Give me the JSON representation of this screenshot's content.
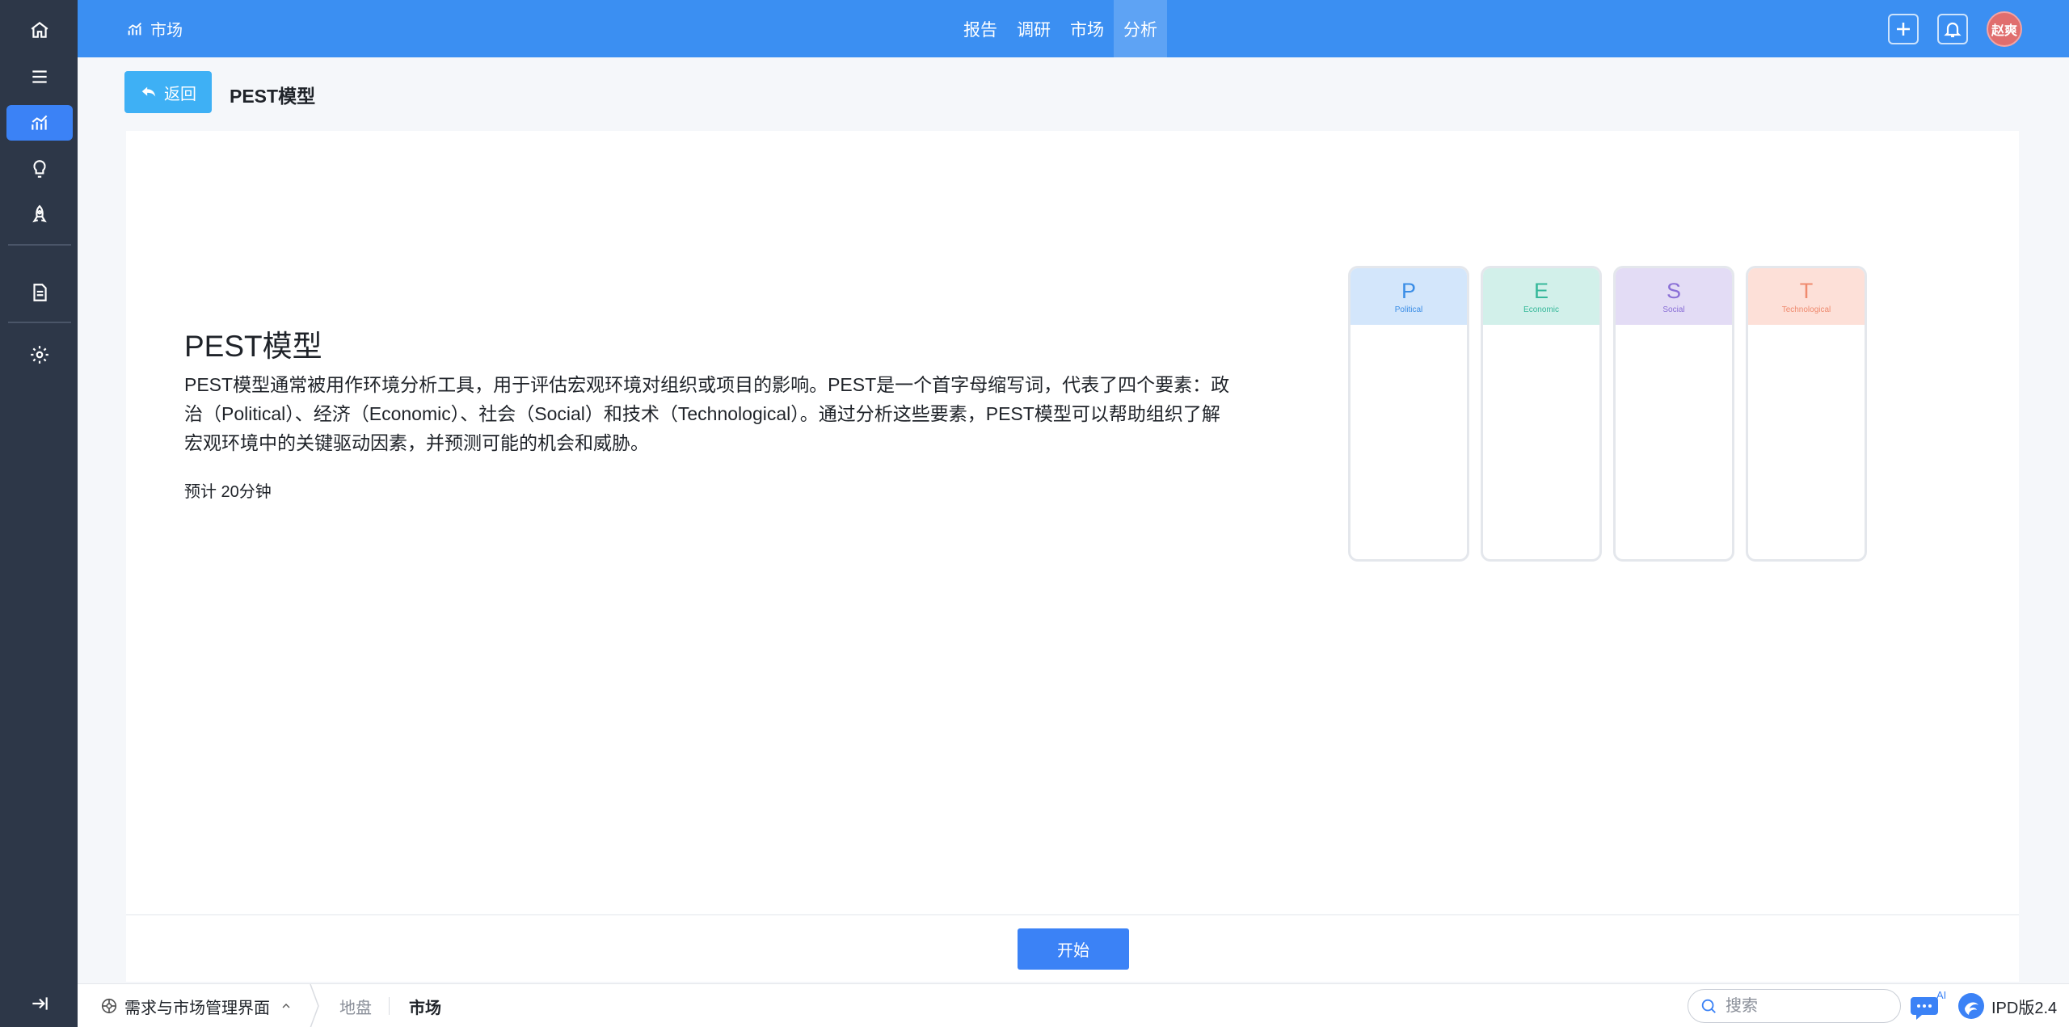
{
  "topbar": {
    "module": "市场",
    "nav": [
      {
        "label": "报告",
        "active": false
      },
      {
        "label": "调研",
        "active": false
      },
      {
        "label": "市场",
        "active": false
      },
      {
        "label": "分析",
        "active": true
      }
    ],
    "avatar_text": "赵爽",
    "avatar_color": "#e06e6e",
    "brand_color": "#3b8ff2"
  },
  "sidebar": {
    "items": [
      {
        "icon": "home-icon"
      },
      {
        "icon": "menu-icon"
      },
      {
        "icon": "chart-icon",
        "active": true
      },
      {
        "icon": "lightbulb-icon"
      },
      {
        "icon": "rocket-icon"
      },
      {
        "icon": "document-icon"
      },
      {
        "icon": "gear-icon"
      },
      {
        "icon": "collapse-icon"
      }
    ]
  },
  "header": {
    "back_label": "返回",
    "title": "PEST模型"
  },
  "main": {
    "model_title": "PEST模型",
    "description": "PEST模型通常被用作环境分析工具，用于评估宏观环境对组织或项目的影响。PEST是一个首字母缩写词，代表了四个要素：政治（Political）、经济（Economic）、社会（Social）和技术（Technological）。通过分析这些要素，PEST模型可以帮助组织了解宏观环境中的关键驱动因素，并预测可能的机会和威胁。",
    "estimate": "预计 20分钟",
    "pest": [
      {
        "letter": "P",
        "word": "Political",
        "bg": "#d3e6fb",
        "fg": "#3a8de6"
      },
      {
        "letter": "E",
        "word": "Economic",
        "bg": "#d2f0ea",
        "fg": "#35b89a"
      },
      {
        "letter": "S",
        "word": "Social",
        "bg": "#e3dcf5",
        "fg": "#8a6fd6"
      },
      {
        "letter": "T",
        "word": "Technological",
        "bg": "#fde0d8",
        "fg": "#ef8a6e"
      }
    ],
    "start_label": "开始"
  },
  "bottombar": {
    "app_name": "需求与市场管理界面",
    "tabs": [
      {
        "label": "地盘",
        "active": false
      },
      {
        "label": "市场",
        "active": true
      }
    ],
    "search_placeholder": "搜索",
    "ai_label": "AI",
    "version": "IPD版2.4"
  }
}
